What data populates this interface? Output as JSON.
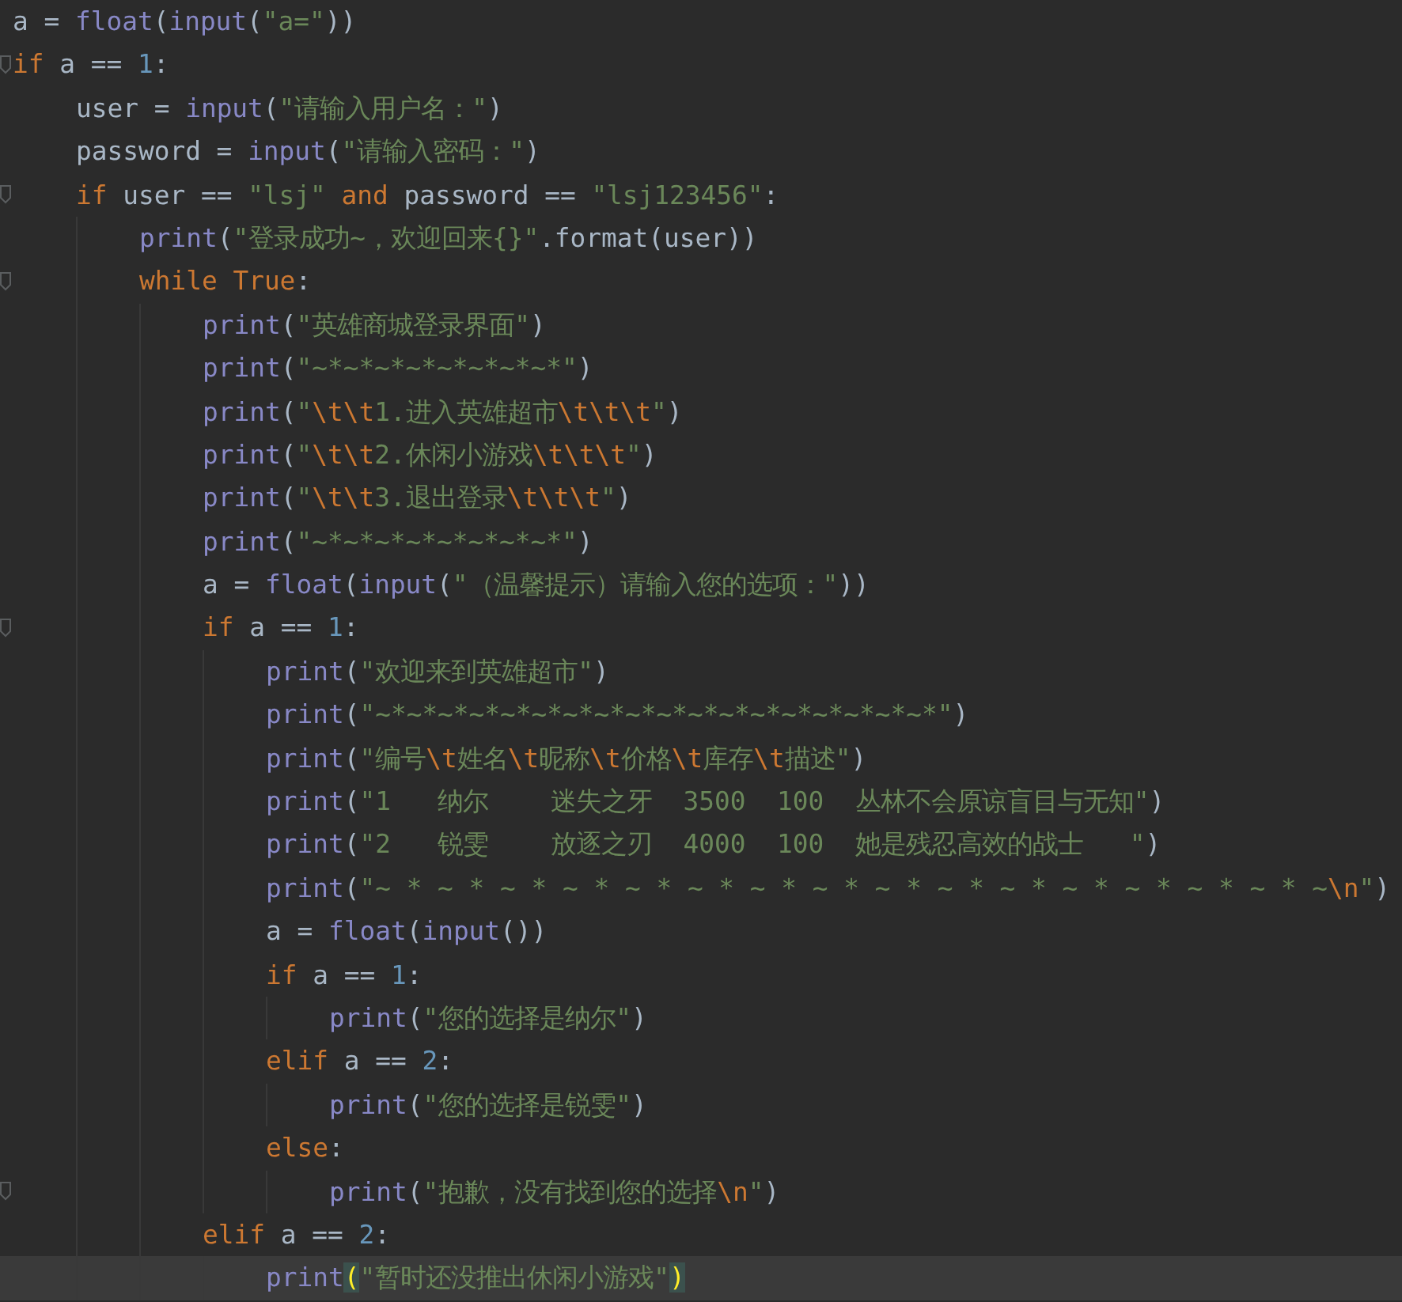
{
  "editor": {
    "lines": [
      {
        "fold": false,
        "current": false,
        "tokens": [
          {
            "kind": "plain",
            "text": "a = "
          },
          {
            "kind": "builtin",
            "text": "float"
          },
          {
            "kind": "plain",
            "text": "("
          },
          {
            "kind": "builtin",
            "text": "input"
          },
          {
            "kind": "plain",
            "text": "("
          },
          {
            "kind": "string",
            "text": "\"a=\""
          },
          {
            "kind": "plain",
            "text": "))"
          }
        ]
      },
      {
        "fold": true,
        "current": false,
        "tokens": [
          {
            "kind": "keyword",
            "text": "if"
          },
          {
            "kind": "plain",
            "text": " a == "
          },
          {
            "kind": "number",
            "text": "1"
          },
          {
            "kind": "plain",
            "text": ":"
          }
        ],
        "children": [
          {
            "fold": false,
            "current": false,
            "tokens": [
              {
                "kind": "plain",
                "text": "user = "
              },
              {
                "kind": "builtin",
                "text": "input"
              },
              {
                "kind": "plain",
                "text": "("
              },
              {
                "kind": "string",
                "text": "\"请输入用户名：\""
              },
              {
                "kind": "plain",
                "text": ")"
              }
            ]
          },
          {
            "fold": false,
            "current": false,
            "tokens": [
              {
                "kind": "plain",
                "text": "password = "
              },
              {
                "kind": "builtin",
                "text": "input"
              },
              {
                "kind": "plain",
                "text": "("
              },
              {
                "kind": "string",
                "text": "\"请输入密码：\""
              },
              {
                "kind": "plain",
                "text": ")"
              }
            ]
          },
          {
            "fold": true,
            "current": false,
            "tokens": [
              {
                "kind": "keyword",
                "text": "if"
              },
              {
                "kind": "plain",
                "text": " user == "
              },
              {
                "kind": "string",
                "text": "\"lsj\""
              },
              {
                "kind": "keyword",
                "text": " and"
              },
              {
                "kind": "plain",
                "text": " password == "
              },
              {
                "kind": "string",
                "text": "\"lsj123456\""
              },
              {
                "kind": "plain",
                "text": ":"
              }
            ],
            "children": [
              {
                "fold": false,
                "current": false,
                "tokens": [
                  {
                    "kind": "builtin",
                    "text": "print"
                  },
                  {
                    "kind": "plain",
                    "text": "("
                  },
                  {
                    "kind": "string",
                    "text": "\"登录成功~，欢迎回来{}\""
                  },
                  {
                    "kind": "plain",
                    "text": ".format(user))"
                  }
                ]
              },
              {
                "fold": true,
                "current": false,
                "tokens": [
                  {
                    "kind": "keyword",
                    "text": "while True"
                  },
                  {
                    "kind": "plain",
                    "text": ":"
                  }
                ],
                "children": [
                  {
                    "fold": false,
                    "current": false,
                    "tokens": [
                      {
                        "kind": "builtin",
                        "text": "print"
                      },
                      {
                        "kind": "plain",
                        "text": "("
                      },
                      {
                        "kind": "string",
                        "text": "\"英雄商城登录界面\""
                      },
                      {
                        "kind": "plain",
                        "text": ")"
                      }
                    ]
                  },
                  {
                    "fold": false,
                    "current": false,
                    "tokens": [
                      {
                        "kind": "builtin",
                        "text": "print"
                      },
                      {
                        "kind": "plain",
                        "text": "("
                      },
                      {
                        "kind": "string",
                        "text": "\"~*~*~*~*~*~*~*~*\""
                      },
                      {
                        "kind": "plain",
                        "text": ")"
                      }
                    ]
                  },
                  {
                    "fold": false,
                    "current": false,
                    "tokens": [
                      {
                        "kind": "builtin",
                        "text": "print"
                      },
                      {
                        "kind": "plain",
                        "text": "("
                      },
                      {
                        "kind": "string",
                        "text": "\""
                      },
                      {
                        "kind": "escape",
                        "text": "\\t\\t"
                      },
                      {
                        "kind": "string",
                        "text": "1.进入英雄超市"
                      },
                      {
                        "kind": "escape",
                        "text": "\\t\\t\\t"
                      },
                      {
                        "kind": "string",
                        "text": "\""
                      },
                      {
                        "kind": "plain",
                        "text": ")"
                      }
                    ]
                  },
                  {
                    "fold": false,
                    "current": false,
                    "tokens": [
                      {
                        "kind": "builtin",
                        "text": "print"
                      },
                      {
                        "kind": "plain",
                        "text": "("
                      },
                      {
                        "kind": "string",
                        "text": "\""
                      },
                      {
                        "kind": "escape",
                        "text": "\\t\\t"
                      },
                      {
                        "kind": "string",
                        "text": "2.休闲小游戏"
                      },
                      {
                        "kind": "escape",
                        "text": "\\t\\t\\t"
                      },
                      {
                        "kind": "string",
                        "text": "\""
                      },
                      {
                        "kind": "plain",
                        "text": ")"
                      }
                    ]
                  },
                  {
                    "fold": false,
                    "current": false,
                    "tokens": [
                      {
                        "kind": "builtin",
                        "text": "print"
                      },
                      {
                        "kind": "plain",
                        "text": "("
                      },
                      {
                        "kind": "string",
                        "text": "\""
                      },
                      {
                        "kind": "escape",
                        "text": "\\t\\t"
                      },
                      {
                        "kind": "string",
                        "text": "3.退出登录"
                      },
                      {
                        "kind": "escape",
                        "text": "\\t\\t\\t"
                      },
                      {
                        "kind": "string",
                        "text": "\""
                      },
                      {
                        "kind": "plain",
                        "text": ")"
                      }
                    ]
                  },
                  {
                    "fold": false,
                    "current": false,
                    "tokens": [
                      {
                        "kind": "builtin",
                        "text": "print"
                      },
                      {
                        "kind": "plain",
                        "text": "("
                      },
                      {
                        "kind": "string",
                        "text": "\"~*~*~*~*~*~*~*~*\""
                      },
                      {
                        "kind": "plain",
                        "text": ")"
                      }
                    ]
                  },
                  {
                    "fold": false,
                    "current": false,
                    "tokens": [
                      {
                        "kind": "plain",
                        "text": "a = "
                      },
                      {
                        "kind": "builtin",
                        "text": "float"
                      },
                      {
                        "kind": "plain",
                        "text": "("
                      },
                      {
                        "kind": "builtin",
                        "text": "input"
                      },
                      {
                        "kind": "plain",
                        "text": "("
                      },
                      {
                        "kind": "string",
                        "text": "\"（温馨提示）请输入您的选项：\""
                      },
                      {
                        "kind": "plain",
                        "text": "))"
                      }
                    ]
                  },
                  {
                    "fold": true,
                    "current": false,
                    "tokens": [
                      {
                        "kind": "keyword",
                        "text": "if"
                      },
                      {
                        "kind": "plain",
                        "text": " a == "
                      },
                      {
                        "kind": "number",
                        "text": "1"
                      },
                      {
                        "kind": "plain",
                        "text": ":"
                      }
                    ],
                    "children": [
                      {
                        "fold": false,
                        "current": false,
                        "tokens": [
                          {
                            "kind": "builtin",
                            "text": "print"
                          },
                          {
                            "kind": "plain",
                            "text": "("
                          },
                          {
                            "kind": "string",
                            "text": "\"欢迎来到英雄超市\""
                          },
                          {
                            "kind": "plain",
                            "text": ")"
                          }
                        ]
                      },
                      {
                        "fold": false,
                        "current": false,
                        "tokens": [
                          {
                            "kind": "builtin",
                            "text": "print"
                          },
                          {
                            "kind": "plain",
                            "text": "("
                          },
                          {
                            "kind": "string",
                            "text": "\"~*~*~*~*~*~*~*~*~*~*~*~*~*~*~*~*~*~*\""
                          },
                          {
                            "kind": "plain",
                            "text": ")"
                          }
                        ]
                      },
                      {
                        "fold": false,
                        "current": false,
                        "tokens": [
                          {
                            "kind": "builtin",
                            "text": "print"
                          },
                          {
                            "kind": "plain",
                            "text": "("
                          },
                          {
                            "kind": "string",
                            "text": "\"编号"
                          },
                          {
                            "kind": "escape",
                            "text": "\\t"
                          },
                          {
                            "kind": "string",
                            "text": "姓名"
                          },
                          {
                            "kind": "escape",
                            "text": "\\t"
                          },
                          {
                            "kind": "string",
                            "text": "昵称"
                          },
                          {
                            "kind": "escape",
                            "text": "\\t"
                          },
                          {
                            "kind": "string",
                            "text": "价格"
                          },
                          {
                            "kind": "escape",
                            "text": "\\t"
                          },
                          {
                            "kind": "string",
                            "text": "库存"
                          },
                          {
                            "kind": "escape",
                            "text": "\\t"
                          },
                          {
                            "kind": "string",
                            "text": "描述\""
                          },
                          {
                            "kind": "plain",
                            "text": ")"
                          }
                        ]
                      },
                      {
                        "fold": false,
                        "current": false,
                        "tokens": [
                          {
                            "kind": "builtin",
                            "text": "print"
                          },
                          {
                            "kind": "plain",
                            "text": "("
                          },
                          {
                            "kind": "string",
                            "text": "\"1   纳尔    迷失之牙  3500  100  丛林不会原谅盲目与无知\""
                          },
                          {
                            "kind": "plain",
                            "text": ")"
                          }
                        ]
                      },
                      {
                        "fold": false,
                        "current": false,
                        "tokens": [
                          {
                            "kind": "builtin",
                            "text": "print"
                          },
                          {
                            "kind": "plain",
                            "text": "("
                          },
                          {
                            "kind": "string",
                            "text": "\"2   锐雯    放逐之刃  4000  100  她是残忍高效的战士   \""
                          },
                          {
                            "kind": "plain",
                            "text": ")"
                          }
                        ]
                      },
                      {
                        "fold": false,
                        "current": false,
                        "tokens": [
                          {
                            "kind": "builtin",
                            "text": "print"
                          },
                          {
                            "kind": "plain",
                            "text": "("
                          },
                          {
                            "kind": "string",
                            "text": "\"~ * ~ * ~ * ~ * ~ * ~ * ~ * ~ * ~ * ~ * ~ * ~ * ~ * ~ * ~ * ~"
                          },
                          {
                            "kind": "escape",
                            "text": "\\n"
                          },
                          {
                            "kind": "string",
                            "text": "\""
                          },
                          {
                            "kind": "plain",
                            "text": ")"
                          }
                        ]
                      },
                      {
                        "fold": false,
                        "current": false,
                        "tokens": [
                          {
                            "kind": "plain",
                            "text": "a = "
                          },
                          {
                            "kind": "builtin",
                            "text": "float"
                          },
                          {
                            "kind": "plain",
                            "text": "("
                          },
                          {
                            "kind": "builtin",
                            "text": "input"
                          },
                          {
                            "kind": "plain",
                            "text": "())"
                          }
                        ]
                      },
                      {
                        "fold": false,
                        "current": false,
                        "tokens": [
                          {
                            "kind": "keyword",
                            "text": "if"
                          },
                          {
                            "kind": "plain",
                            "text": " a == "
                          },
                          {
                            "kind": "number",
                            "text": "1"
                          },
                          {
                            "kind": "plain",
                            "text": ":"
                          }
                        ],
                        "children": [
                          {
                            "fold": false,
                            "current": false,
                            "tokens": [
                              {
                                "kind": "builtin",
                                "text": "print"
                              },
                              {
                                "kind": "plain",
                                "text": "("
                              },
                              {
                                "kind": "string",
                                "text": "\"您的选择是纳尔\""
                              },
                              {
                                "kind": "plain",
                                "text": ")"
                              }
                            ]
                          }
                        ]
                      },
                      {
                        "fold": false,
                        "current": false,
                        "tokens": [
                          {
                            "kind": "keyword",
                            "text": "elif"
                          },
                          {
                            "kind": "plain",
                            "text": " a == "
                          },
                          {
                            "kind": "number",
                            "text": "2"
                          },
                          {
                            "kind": "plain",
                            "text": ":"
                          }
                        ],
                        "children": [
                          {
                            "fold": false,
                            "current": false,
                            "tokens": [
                              {
                                "kind": "builtin",
                                "text": "print"
                              },
                              {
                                "kind": "plain",
                                "text": "("
                              },
                              {
                                "kind": "string",
                                "text": "\"您的选择是锐雯\""
                              },
                              {
                                "kind": "plain",
                                "text": ")"
                              }
                            ]
                          }
                        ]
                      },
                      {
                        "fold": false,
                        "current": false,
                        "tokens": [
                          {
                            "kind": "keyword",
                            "text": "else"
                          },
                          {
                            "kind": "plain",
                            "text": ":"
                          }
                        ],
                        "children": [
                          {
                            "fold": true,
                            "current": false,
                            "tokens": [
                              {
                                "kind": "builtin",
                                "text": "print"
                              },
                              {
                                "kind": "plain",
                                "text": "("
                              },
                              {
                                "kind": "string",
                                "text": "\"抱歉，没有找到您的选择"
                              },
                              {
                                "kind": "escape",
                                "text": "\\n"
                              },
                              {
                                "kind": "string",
                                "text": "\""
                              },
                              {
                                "kind": "plain",
                                "text": ")"
                              }
                            ]
                          }
                        ]
                      }
                    ]
                  },
                  {
                    "fold": false,
                    "current": false,
                    "tokens": [
                      {
                        "kind": "keyword",
                        "text": "elif"
                      },
                      {
                        "kind": "plain",
                        "text": " a == "
                      },
                      {
                        "kind": "number",
                        "text": "2"
                      },
                      {
                        "kind": "plain",
                        "text": ":"
                      }
                    ],
                    "children": [
                      {
                        "fold": false,
                        "current": true,
                        "tokens": [
                          {
                            "kind": "builtin",
                            "text": "print"
                          },
                          {
                            "kind": "matched",
                            "text": "("
                          },
                          {
                            "kind": "string",
                            "text": "\"暂时还没推出休闲小游戏\""
                          },
                          {
                            "kind": "matched",
                            "text": ")"
                          }
                        ]
                      }
                    ]
                  }
                ]
              }
            ]
          }
        ]
      }
    ]
  }
}
